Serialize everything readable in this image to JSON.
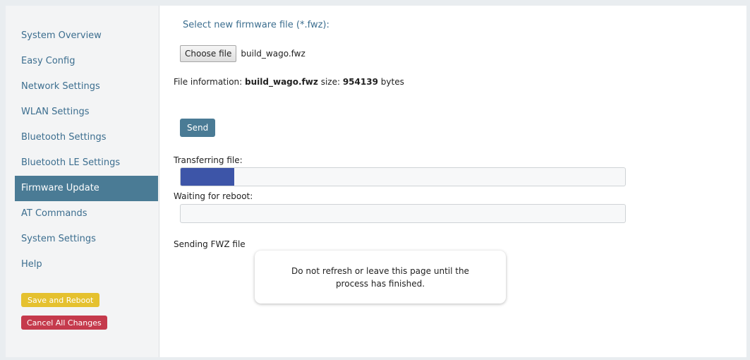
{
  "sidebar": {
    "items": [
      {
        "label": "System Overview"
      },
      {
        "label": "Easy Config"
      },
      {
        "label": "Network Settings"
      },
      {
        "label": "WLAN Settings"
      },
      {
        "label": "Bluetooth Settings"
      },
      {
        "label": "Bluetooth LE Settings"
      },
      {
        "label": "Firmware Update",
        "active": true
      },
      {
        "label": "AT Commands"
      },
      {
        "label": "System Settings"
      },
      {
        "label": "Help"
      }
    ],
    "save_label": "Save and Reboot",
    "cancel_label": "Cancel All Changes"
  },
  "firmware": {
    "select_label": "Select new firmware file (*.fwz):",
    "choose_button": "Choose file",
    "selected_file": "build_wago.fwz",
    "info_prefix": "File information:",
    "info_file": "build_wago.fwz",
    "size_prefix": "size:",
    "size_value": "954139",
    "size_unit": "bytes",
    "send_label": "Send",
    "transfer_label": "Transferring file:",
    "transfer_progress": 0.12,
    "reboot_label": "Waiting for reboot:",
    "reboot_progress": 0,
    "status_text": "Sending FWZ file",
    "notice_text": "Do not refresh or leave this page until the process has finished."
  },
  "colors": {
    "accent": "#4a7b95",
    "progress": "#3d55a8",
    "save": "#e5c12f",
    "cancel": "#c53a4c"
  }
}
